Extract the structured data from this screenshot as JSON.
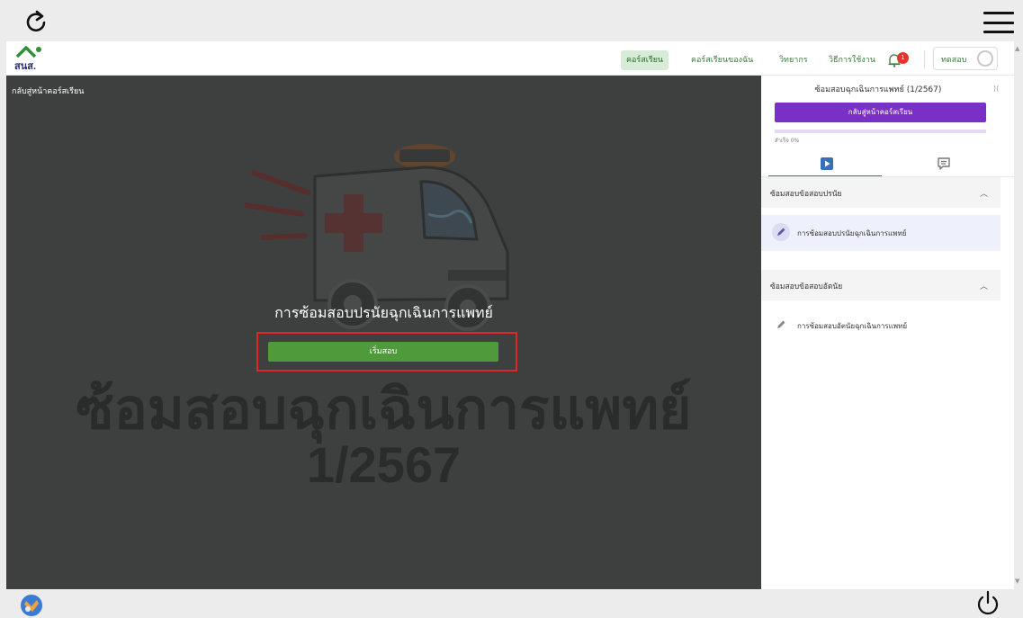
{
  "navbar": {
    "logo_text": "สนส.",
    "items": [
      {
        "label": "คอร์สเรียน",
        "active": true
      },
      {
        "label": "คอร์สเรียนของฉัน",
        "active": false
      },
      {
        "label": "วิทยากร",
        "active": false
      },
      {
        "label": "วิธีการใช้งาน",
        "active": false
      }
    ],
    "notification_count": "1",
    "user_name": "ทดสอบ"
  },
  "stage": {
    "back_label": "กลับสู่หน้าคอร์สเรียน",
    "background_title_line1": "ซ้อมสอบฉุกเฉินการแพทย์",
    "background_title_line2": "1/2567",
    "quiz_title": "การซ้อมสอบปรนัยฉุกเฉินการแพทย์",
    "start_button": "เริ่มสอบ"
  },
  "panel": {
    "course_title": "ซ้อมสอบฉุกเฉินการแพทย์ (1/2567)",
    "collapse_label": "⟩⟨",
    "back_button": "กลับสู่หน้าคอร์สเรียน",
    "progress_text": "สำเร็จ 0%",
    "progress_percent": 0,
    "sections": [
      {
        "title": "ซ้อมสอบข้อสอบปรนัย",
        "lessons": [
          {
            "title": "การซ้อมสอบปรนัยฉุกเฉินการแพทย์",
            "active": true
          }
        ]
      },
      {
        "title": "ซ้อมสอบข้อสอบอัตนัย",
        "lessons": [
          {
            "title": "การซ้อมสอบอัตนัยฉุกเฉินการแพทย์",
            "active": false
          }
        ]
      }
    ]
  },
  "colors": {
    "accent_purple": "#7a2fc7",
    "start_green": "#4f9b3c",
    "highlight_red": "#e0262a",
    "nav_green": "#3a7a3a"
  },
  "icons": {
    "refresh": "refresh-icon",
    "menu": "hamburger-menu-icon",
    "bell": "bell-icon",
    "video_tab": "video-play-icon",
    "chat_tab": "chat-icon",
    "lesson": "pencil-icon",
    "power": "power-icon"
  }
}
